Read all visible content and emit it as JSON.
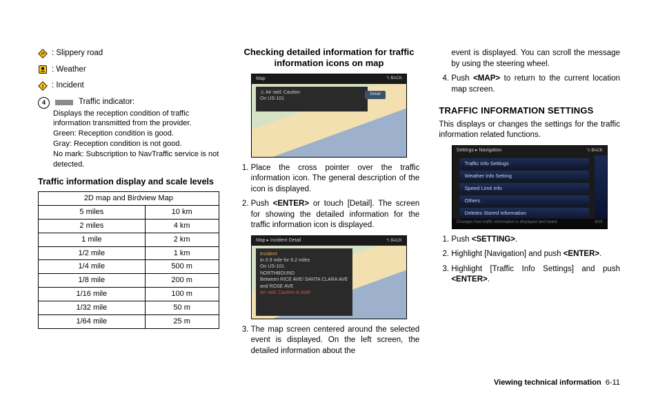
{
  "col1": {
    "legend": {
      "slippery": ": Slippery road",
      "weather": ": Weather",
      "incident": ": Incident"
    },
    "indicator": {
      "num": "4",
      "label": "Traffic indicator:",
      "line1": "Displays the reception condition of traffic information transmitted from the provider.",
      "line2": "Green: Reception condition is good.",
      "line3": "Gray: Reception condition is not good.",
      "line4": "No mark: Subscription to NavTraffic service is not detected."
    },
    "scale_title": "Traffic information display and scale levels",
    "table": {
      "header": "2D map and Birdview Map",
      "rows": [
        [
          "5 miles",
          "10 km"
        ],
        [
          "2 miles",
          "4 km"
        ],
        [
          "1 mile",
          "2 km"
        ],
        [
          "1/2 mile",
          "1 km"
        ],
        [
          "1/4 mile",
          "500 m"
        ],
        [
          "1/8 mile",
          "200 m"
        ],
        [
          "1/16 mile",
          "100 m"
        ],
        [
          "1/32 mile",
          "50 m"
        ],
        [
          "1/64 mile",
          "25 m"
        ]
      ]
    }
  },
  "col2": {
    "title": "Checking detailed information for traffic information icons on map",
    "ss1_top": "Map",
    "ss1_back": "⮌ BACK",
    "ss1_overlay_l1": "⚠ Air raid: Caution",
    "ss1_overlay_l2": "On US-101",
    "ss1_detail": "Detail",
    "step1": "Place the cross pointer over the traffic information icon. The general description of the icon is displayed.",
    "step2_a": "Push ",
    "step2_b": "<ENTER>",
    "step2_c": " or touch [Detail]. The screen for showing the detailed information for the traffic information icon is displayed.",
    "ss2_top": "Map ▸ Incident Detail",
    "ss2_overlay_t": "Incident",
    "ss2_overlay_1": "In 0.9 mile for 6.2 miles",
    "ss2_overlay_2": "On US-101",
    "ss2_overlay_3": "NORTHBOUND",
    "ss2_overlay_4": "Between RICE AVE/ SANTA CLARA AVE and ROSE AVE",
    "ss2_overlay_5": "Air raid: Caution in both",
    "step3": "The map screen centered around the selected event is displayed. On the left screen, the detailed information about the"
  },
  "col3": {
    "cont": "event is displayed. You can scroll the message by using the steering wheel.",
    "step4_a": "Push ",
    "step4_b": "<MAP>",
    "step4_c": " to return to the current location map screen.",
    "settings_title": "TRAFFIC INFORMATION SETTINGS",
    "settings_intro": "This displays or changes the settings for the traffic information related functions.",
    "ss3_top": "Settings ▸ Navigation",
    "menu": [
      "Traffic Info Settings",
      "Weather Info Setting",
      "Speed Limit Info",
      "Others",
      "Deletes Stored Information"
    ],
    "ss3_foot": "Changes how traffic information is displayed and heard",
    "ss3_count": "4/15",
    "s1_a": "Push ",
    "s1_b": "<SETTING>",
    "s1_c": ".",
    "s2_a": "Highlight [Navigation] and push ",
    "s2_b": "<ENTER>",
    "s2_c": ".",
    "s3_a": "Highlight [Traffic Info Settings] and push ",
    "s3_b": "<ENTER>",
    "s3_c": "."
  },
  "footer": {
    "section": "Viewing technical information",
    "page": "6-11"
  }
}
